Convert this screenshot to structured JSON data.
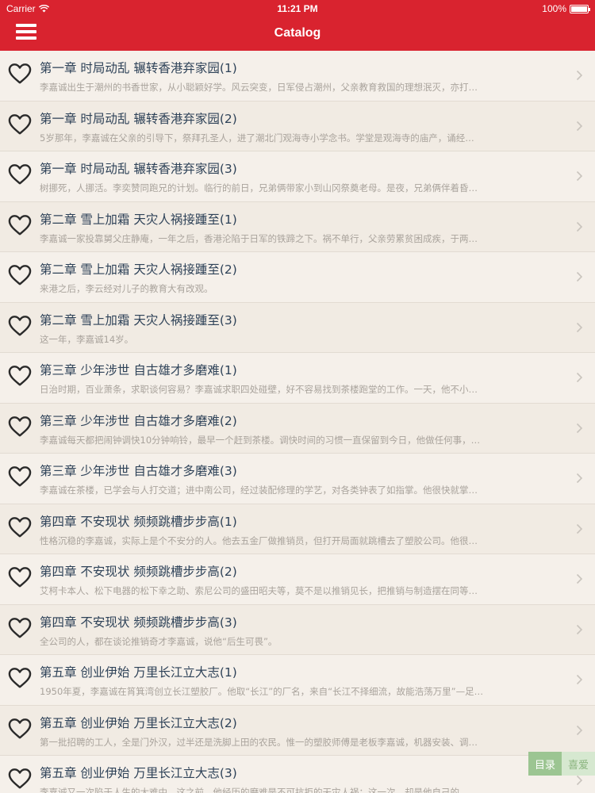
{
  "status_bar": {
    "carrier": "Carrier",
    "time": "11:21 PM",
    "battery": "100%"
  },
  "nav": {
    "title": "Catalog",
    "menu_icon": "hamburger-menu-icon"
  },
  "colors": {
    "nav_bg": "#d9232f",
    "title_text": "#2e4258",
    "subtitle_text": "#a9a39c"
  },
  "chapters": [
    {
      "title": "第一章 时局动乱 辗转香港弃家园(1)",
      "summary": "李嘉诚出生于潮州的书香世家，从小聪颖好学。风云突变，日军侵占潮州，父亲教育救国的理想泯灭，亦打…"
    },
    {
      "title": "第一章 时局动乱 辗转香港弃家园(2)",
      "summary": "5岁那年，李嘉诚在父亲的引导下，祭拜孔圣人，进了潮北门观海寺小学念书。学堂是观海寺的庙产，诵经…"
    },
    {
      "title": "第一章 时局动乱 辗转香港弃家园(3)",
      "summary": "树挪死，人挪活。李奕赞同跑兄的计划。临行的前日，兄弟俩带家小到山冈祭奠老母。是夜，兄弟俩伴着昏…"
    },
    {
      "title": "第二章 雪上加霜 天灾人祸接踵至(1)",
      "summary": "李嘉诚一家投靠舅父庄静庵，一年之后，香港沦陷于日军的铁蹄之下。祸不单行，父亲劳累贫困成疾，于两…"
    },
    {
      "title": "第二章 雪上加霜 天灾人祸接踵至(2)",
      "summary": "来港之后，李云经对儿子的教育大有改观。"
    },
    {
      "title": "第二章 雪上加霜 天灾人祸接踵至(3)",
      "summary": "这一年，李嘉诚14岁。"
    },
    {
      "title": "第三章 少年涉世 自古雄才多磨难(1)",
      "summary": "日治时期，百业萧条，求职谈何容易？李嘉诚求职四处碰壁，好不容易找到茶楼跑堂的工作。一天，他不小…"
    },
    {
      "title": "第三章 少年涉世 自古雄才多磨难(2)",
      "summary": "李嘉诚每天都把闹钟调快10分钟响铃，最早一个赶到茶楼。调快时间的习惯一直保留到今日，他做任何事，…"
    },
    {
      "title": "第三章 少年涉世 自古雄才多磨难(3)",
      "summary": "李嘉诚在茶楼，已学会与人打交道；进中南公司，经过装配修理的学艺，对各类钟表了如指掌。他很快就掌…"
    },
    {
      "title": "第四章 不安现状 频频跳槽步步高(1)",
      "summary": "性格沉稳的李嘉诚，实际上是个不安分的人。他去五金厂做推销员，但打开局面就跳槽去了塑胶公司。他很…"
    },
    {
      "title": "第四章 不安现状 频频跳槽步步高(2)",
      "summary": "艾柯卡本人、松下电器的松下幸之助、索尼公司的盛田昭夫等，莫不是以推销见长，把推销与制造摆在同等…"
    },
    {
      "title": "第四章 不安现状 频频跳槽步步高(3)",
      "summary": "全公司的人，都在谈论推销奇才李嘉诚，说他“后生可畏”。"
    },
    {
      "title": "第五章 创业伊始 万里长江立大志(1)",
      "summary": "1950年夏，李嘉诚在筲箕湾创立长江塑胶厂。他取“长江”的厂名，来自“长江不择细流，故能浩荡万里”—足…"
    },
    {
      "title": "第五章 创业伊始 万里长江立大志(2)",
      "summary": "第一批招聘的工人，全是门外汉，过半还是洗脚上田的农民。惟一的塑胶师傅是老板李嘉诚，机器安装、调…"
    },
    {
      "title": "第五章 创业伊始 万里长江立大志(3)",
      "summary": "李嘉诚又一次陷于人生的大难中。这之前，他经历的磨难是不可抗拒的天灾人祸；这一次，却是他自己的…"
    }
  ],
  "bottom_tabs": {
    "catalog": "目录",
    "favorites": "喜爱"
  }
}
